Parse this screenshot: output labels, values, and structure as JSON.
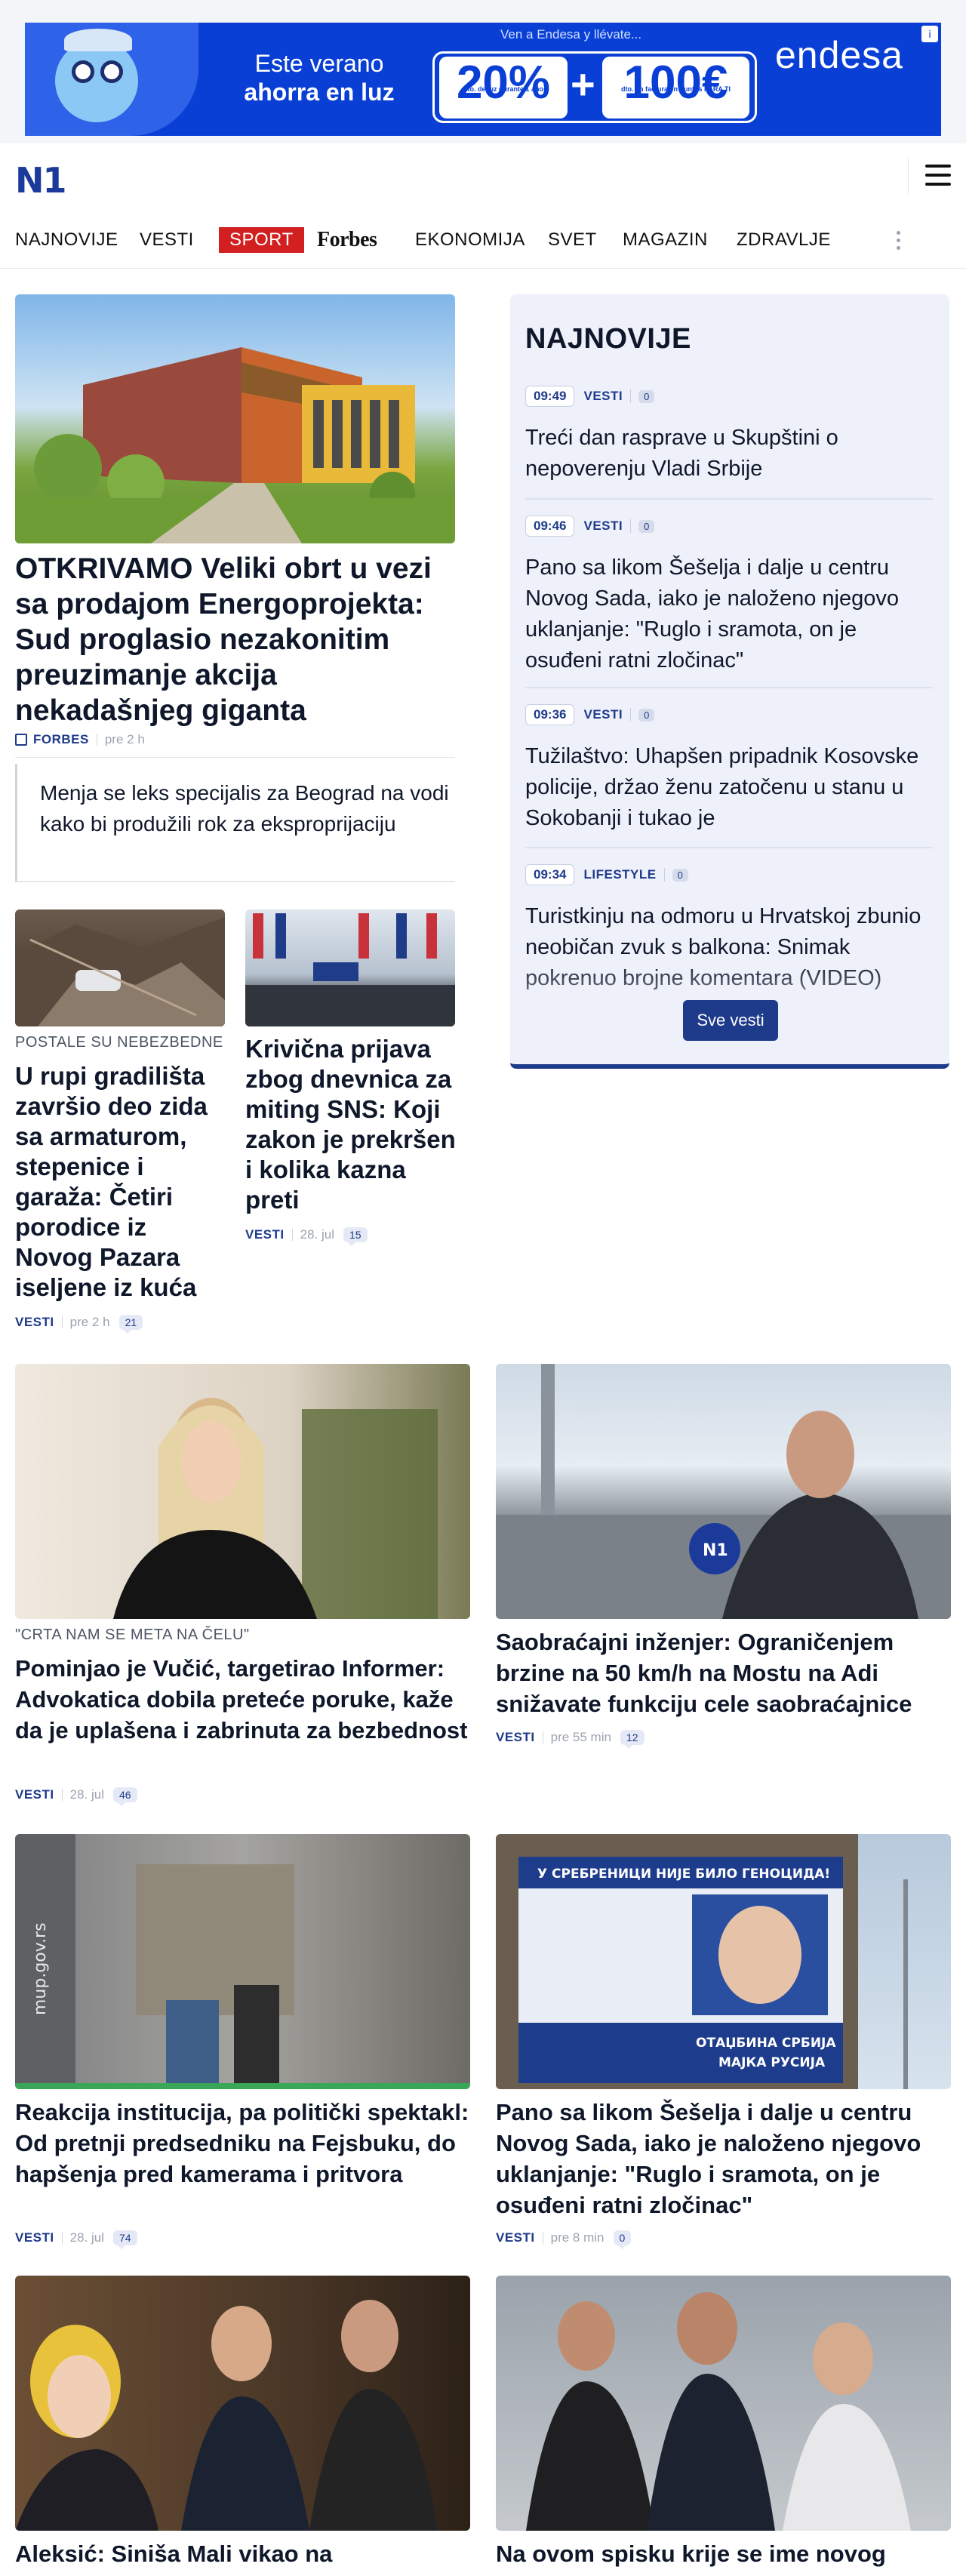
{
  "ad": {
    "headline_1": "Este verano",
    "headline_2": "ahorra en luz",
    "tagline": "Ven a Endesa y llévate...",
    "pct": "20%",
    "plus": "+",
    "eur": "100€",
    "fine_1": "dto. de luz durante 1 año",
    "fine_2": "dto. en factura en puntos PARA TI",
    "brand": "endesa",
    "info": "i"
  },
  "header": {
    "logo": "N1"
  },
  "nav": {
    "items": [
      "NAJNOVIJE",
      "VESTI",
      "SPORT",
      "Forbes",
      "EKONOMIJA",
      "SVET",
      "MAGAZIN",
      "ZDRAVLJE"
    ]
  },
  "lead": {
    "headline": "OTKRIVAMO Veliki obrt u vezi sa prodajom Energoprojekta: Sud proglasio nezakonitim preuzimanje akcija nekadašnjeg giganta",
    "category": "FORBES",
    "time": "pre 2 h",
    "related": "Menja se leks specijalis za Beograd na vodi kako bi produžili rok za eksproprijaciju"
  },
  "small_left": {
    "kicker": "POSTALE SU NEBEZBEDNE",
    "headline": "U rupi gradilišta završio deo zida sa armaturom, stepenice i garaža: Četiri porodice iz Novog Pazara iseljene iz kuća",
    "category": "VESTI",
    "time": "pre 2 h",
    "comments": "21"
  },
  "small_right": {
    "headline": "Krivična prijava zbog dnevnica za miting SNS: Koji zakon je prekršen i kolika kazna preti",
    "category": "VESTI",
    "time": "28. jul",
    "comments": "15"
  },
  "latest": {
    "title": "NAJNOVIJE",
    "items": [
      {
        "time": "09:49",
        "category": "VESTI",
        "comments": "0",
        "text": "Treći dan rasprave u Skupštini o nepoverenju Vladi Srbije"
      },
      {
        "time": "09:46",
        "category": "VESTI",
        "comments": "0",
        "text": "Pano sa likom Šešelja i dalje u centru Novog Sada, iako je naloženo njegovo uklanjanje: \"Ruglo i sramota, on je osuđeni ratni zločinac\""
      },
      {
        "time": "09:36",
        "category": "VESTI",
        "comments": "0",
        "text": "Tužilaštvo: Uhapšen pripadnik Kosovske policije, držao ženu zatočenu u stanu u Sokobanji i tukao je"
      },
      {
        "time": "09:34",
        "category": "LIFESTYLE",
        "comments": "0",
        "text": "Turistkinju na odmoru u Hrvatskoj zbunio neobičan zvuk s balkona: Snimak pokrenuo brojne komentara (VIDEO)"
      }
    ],
    "button": "Sve vesti"
  },
  "grid": [
    {
      "kicker": "\"CRTA NAM SE META NA ČELU\"",
      "headline": "Pominjao je Vučić, targetirao Informer: Advokatica dobila preteće poruke, kaže da je uplašena i zabrinuta za bezbednost",
      "category": "VESTI",
      "time": "28. jul",
      "comments": "46"
    },
    {
      "headline": "Saobraćajni inženjer: Ograničenjem brzine na 50 km/h na Mostu na Adi snižavate funkciju cele saobraćajnice",
      "category": "VESTI",
      "time": "pre 55 min",
      "comments": "12"
    },
    {
      "headline": "Reakcija institucija, pa politički spektakl: Od pretnji predsedniku na Fejsbuku, do hapšenja pred kamerama i pritvora",
      "category": "VESTI",
      "time": "28. jul",
      "comments": "74"
    },
    {
      "headline": "Pano sa likom Šešelja i dalje u centru Novog Sada, iako je naloženo njegovo uklanjanje: \"Ruglo i sramota, on je osuđeni ratni zločinac\"",
      "category": "VESTI",
      "time": "pre 8 min",
      "comments": "0"
    },
    {
      "headline": "Aleksić: Siniša Mali vikao na"
    },
    {
      "headline": "Na ovom spisku krije se ime novog"
    }
  ],
  "image_text": {
    "watermark": "mup.gov.rs",
    "billboard_top": "У СРЕБРЕНИЦИ НИЈЕ БИЛО ГЕНОЦИДА!",
    "billboard_bottom_1": "ОТАЏБИНА СРБИЈА",
    "billboard_bottom_2": "МАЈКА РУСИЈА",
    "mic": "N1"
  }
}
